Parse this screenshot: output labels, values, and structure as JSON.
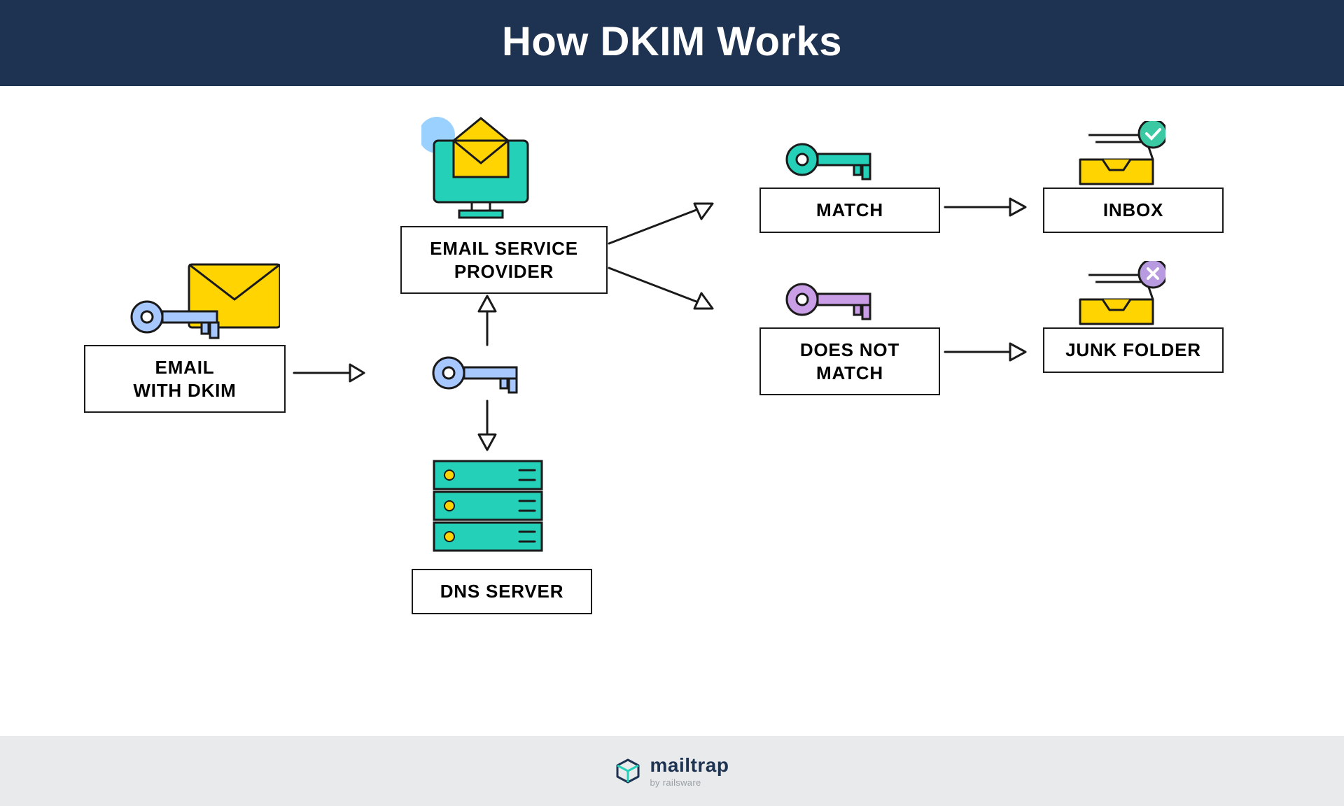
{
  "header": {
    "title": "How DKIM Works"
  },
  "nodes": {
    "email_with_dkim": "EMAIL\nWITH DKIM",
    "email_service_provider": "EMAIL SERVICE\nPROVIDER",
    "dns_server": "DNS SERVER",
    "match": "MATCH",
    "does_not_match": "DOES NOT\nMATCH",
    "inbox": "INBOX",
    "junk_folder": "JUNK FOLDER"
  },
  "footer": {
    "brand_name": "mailtrap",
    "brand_by": "by railsware"
  }
}
